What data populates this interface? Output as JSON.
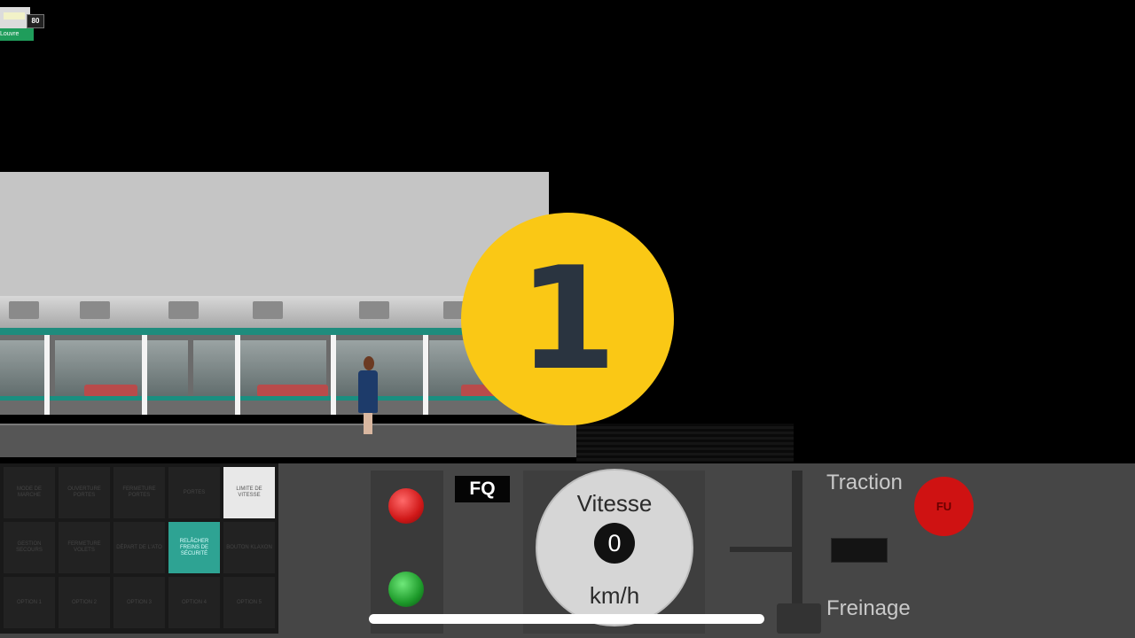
{
  "signal": {
    "speed_limit": "80",
    "station_name": "Louvre"
  },
  "step_badge": {
    "number": "1"
  },
  "dashboard": {
    "buttons": [
      "Mode de marche",
      "Ouverture portes",
      "Fermeture portes",
      "Portes",
      "Limite de vitesse",
      "Gestion secours",
      "Fermeture volets",
      "Départ de l'ATO",
      "Relâcher freins de sécurité",
      "Bouton klaxon",
      "Option 1",
      "Option 2",
      "Option 3",
      "Option 4",
      "Option 5"
    ],
    "fq_label": "FQ",
    "speed_title": "Vitesse",
    "speed_value": "0",
    "speed_unit": "km/h",
    "traction_label": "Traction",
    "braking_label": "Freinage",
    "fu_label": "FU"
  }
}
